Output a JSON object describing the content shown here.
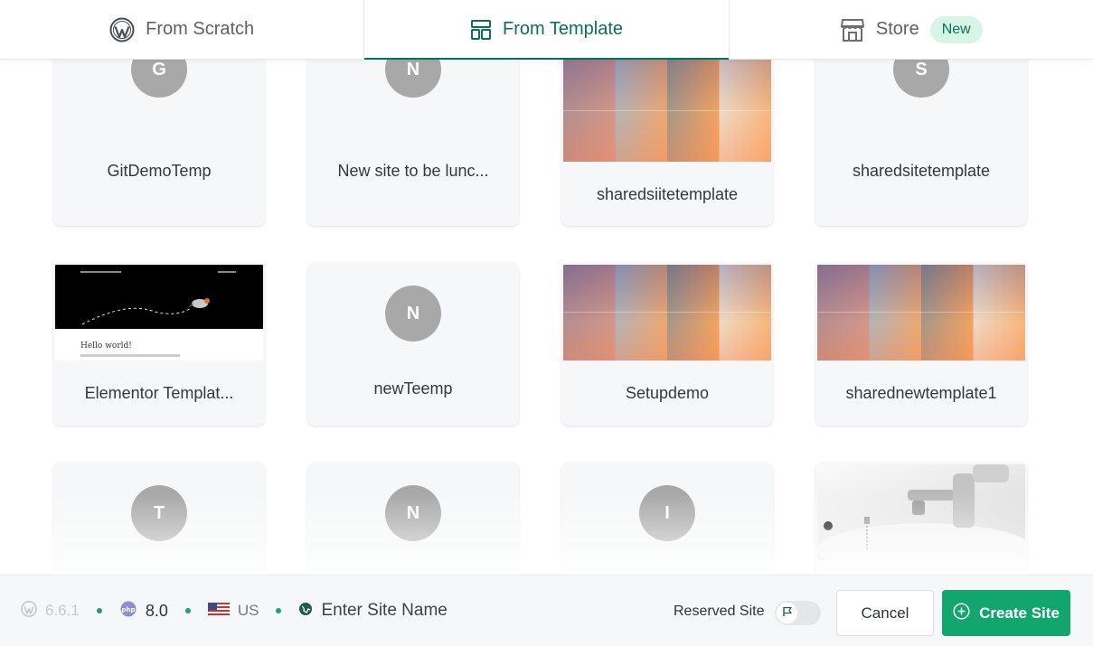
{
  "tabs": [
    {
      "label": "From Scratch",
      "icon": "wordpress-icon",
      "active": false
    },
    {
      "label": "From Template",
      "icon": "template-icon",
      "active": true
    },
    {
      "label": "Store",
      "icon": "store-icon",
      "active": false,
      "badge": "New"
    }
  ],
  "templates": [
    {
      "name": "GitDemoTemp",
      "avatar": "G"
    },
    {
      "name": "New site to be lunc...",
      "avatar": "N"
    },
    {
      "name": "sharedsiitetemplate",
      "thumbnail": "sunset"
    },
    {
      "name": "sharedsitetemplate",
      "avatar": "S"
    },
    {
      "name": "Elementor Templat...",
      "thumbnail": "elementor",
      "thumbnail_text": "Hello world!"
    },
    {
      "name": "newTeemp",
      "avatar": "N"
    },
    {
      "name": "Setupdemo",
      "thumbnail": "sunset"
    },
    {
      "name": "sharednewtemplate1",
      "thumbnail": "sunset"
    },
    {
      "name": "",
      "avatar": "T"
    },
    {
      "name": "",
      "avatar": "N"
    },
    {
      "name": "",
      "avatar": "I"
    },
    {
      "name": "",
      "thumbnail": "sink"
    }
  ],
  "footer": {
    "wp_version": "6.6.1",
    "php_version": "8.0",
    "country": "US",
    "site_name_placeholder": "Enter Site Name",
    "reserved_label": "Reserved Site",
    "reserved_enabled": false,
    "cancel_label": "Cancel",
    "create_label": "Create Site"
  },
  "colors": {
    "accent": "#0f6e5a",
    "primary_button": "#12a56e",
    "status_dot": "#1aa37a",
    "avatar_bg": "#a8a8a8"
  }
}
